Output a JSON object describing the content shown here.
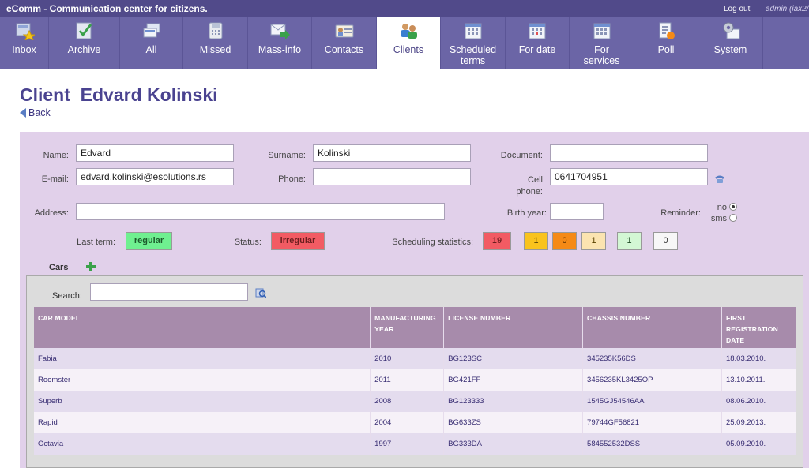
{
  "app": {
    "title": "eComm - Communication center for citizens.",
    "logout": "Log out",
    "user": "admin (iax2/"
  },
  "nav": {
    "items": [
      {
        "label": "Inbox",
        "icon": "inbox-icon"
      },
      {
        "label": "Archive",
        "icon": "archive-icon"
      },
      {
        "label": "All",
        "icon": "all-icon"
      },
      {
        "label": "Missed",
        "icon": "missed-phone-icon"
      },
      {
        "label": "Mass-info",
        "icon": "mass-info-icon"
      },
      {
        "label": "Contacts",
        "icon": "contacts-card-icon"
      },
      {
        "label": "Clients",
        "icon": "clients-people-icon"
      },
      {
        "label": "Scheduled terms",
        "icon": "calendar-icon"
      },
      {
        "label": "For date",
        "icon": "calendar-date-icon"
      },
      {
        "label": "For services",
        "icon": "calendar-services-icon"
      },
      {
        "label": "Poll",
        "icon": "poll-icon"
      },
      {
        "label": "System",
        "icon": "system-gear-icon"
      }
    ],
    "active": "Clients"
  },
  "page": {
    "title": "Client  Edvard Kolinski",
    "back": "Back"
  },
  "form": {
    "name_label": "Name:",
    "name_value": "Edvard",
    "surname_label": "Surname:",
    "surname_value": "Kolinski",
    "document_label": "Document:",
    "document_value": "",
    "email_label": "E-mail:",
    "email_value": "edvard.kolinski@esolutions.rs",
    "phone_label": "Phone:",
    "phone_value": "",
    "cell_label_1": "Cell",
    "cell_label_2": "phone:",
    "cell_value": "0641704951",
    "address_label": "Address:",
    "address_value": "",
    "birth_label": "Birth year:",
    "birth_value": "",
    "reminder_label": "Reminder:",
    "reminder_no": "no",
    "reminder_sms": "sms",
    "reminder_selected": "no"
  },
  "stats": {
    "last_term_label": "Last term:",
    "last_term_value": "regular",
    "status_label": "Status:",
    "status_value": "irregular",
    "scheduling_label": "Scheduling statistics:",
    "counts": [
      {
        "value": "19",
        "color": "#f25b63"
      },
      {
        "value": "1",
        "color": "#f9c31d"
      },
      {
        "value": "0",
        "color": "#f58a16"
      },
      {
        "value": "1",
        "color": "#fbe4b0"
      },
      {
        "value": "1",
        "color": "#d3f7d4"
      },
      {
        "value": "0",
        "color": "#f7f7f7"
      }
    ],
    "colors": {
      "regular": "#6ff090",
      "irregular": "#f25b63"
    }
  },
  "cars": {
    "title": "Cars",
    "search_label": "Search:",
    "search_value": "",
    "columns": [
      "Car model",
      "Manufacturing year",
      "License number",
      "Chassis number",
      "First registration date"
    ],
    "rows": [
      [
        "Fabia",
        "2010",
        "BG123SC",
        "345235K56DS",
        "18.03.2010."
      ],
      [
        "Roomster",
        "2011",
        "BG421FF",
        "3456235KL3425OP",
        "13.10.2011."
      ],
      [
        "Superb",
        "2008",
        "BG123333",
        "1545GJ54546AA",
        "08.06.2010."
      ],
      [
        "Rapid",
        "2004",
        "BG633ZS",
        "79744GF56821",
        "25.09.2013."
      ],
      [
        "Octavia",
        "1997",
        "BG333DA",
        "584552532DSS",
        "05.09.2010."
      ]
    ]
  }
}
